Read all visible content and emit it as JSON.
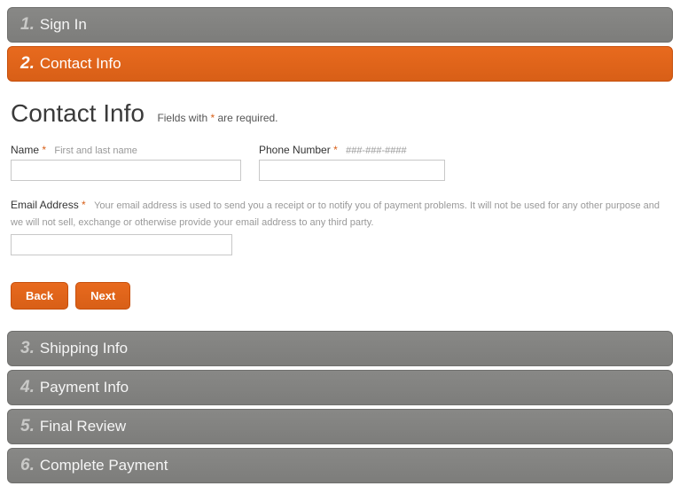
{
  "steps": {
    "s1": {
      "num": "1.",
      "title": "Sign In"
    },
    "s2": {
      "num": "2.",
      "title": "Contact Info"
    },
    "s3": {
      "num": "3.",
      "title": "Shipping Info"
    },
    "s4": {
      "num": "4.",
      "title": "Payment Info"
    },
    "s5": {
      "num": "5.",
      "title": "Final Review"
    },
    "s6": {
      "num": "6.",
      "title": "Complete Payment"
    }
  },
  "content": {
    "heading": "Contact Info",
    "required_hint_prefix": "Fields with ",
    "required_star": "*",
    "required_hint_suffix": " are required.",
    "name": {
      "label": "Name",
      "star": "*",
      "hint": "First and last name",
      "value": ""
    },
    "phone": {
      "label": "Phone Number",
      "star": "*",
      "hint": "###-###-####",
      "value": ""
    },
    "email": {
      "label": "Email Address",
      "star": "*",
      "desc": "Your email address is used to send you a receipt or to notify you of payment problems. It will not be used for any other purpose and we will not sell, exchange or otherwise provide your email address to any third party.",
      "value": ""
    },
    "buttons": {
      "back": "Back",
      "next": "Next"
    }
  }
}
